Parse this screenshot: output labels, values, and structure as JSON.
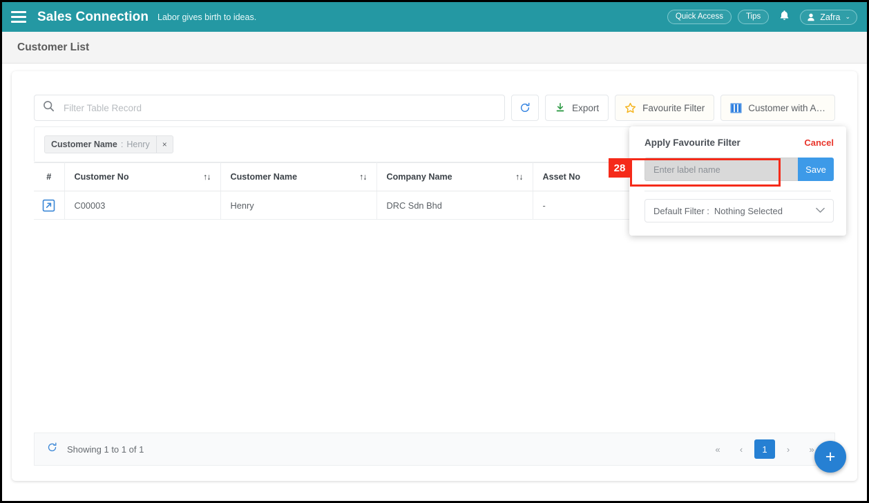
{
  "header": {
    "menu_icon": "hamburger-icon",
    "brand": "Sales Connection",
    "tagline": "Labor gives birth to ideas.",
    "quick_access": "Quick Access",
    "tips": "Tips",
    "bell_icon": "bell-icon",
    "user_name": "Zafra",
    "caret": "⌄",
    "teal": "#2498a3"
  },
  "page": {
    "title": "Customer List"
  },
  "toolbar": {
    "search_placeholder": "Filter Table Record",
    "search_value": "",
    "refresh_label": "",
    "export_label": "Export",
    "favourite_filter_label": "Favourite Filter",
    "column_chooser_label": "Customer with A…"
  },
  "filter_chips": [
    {
      "field": "Customer Name",
      "separator": ":",
      "value": "Henry",
      "remove": "×"
    }
  ],
  "table": {
    "columns": [
      {
        "label": "#",
        "sortable": false
      },
      {
        "label": "Customer No",
        "sortable": true
      },
      {
        "label": "Customer Name",
        "sortable": true
      },
      {
        "label": "Company Name",
        "sortable": true
      },
      {
        "label": "Asset No",
        "sortable": false
      }
    ],
    "sort_glyph": "↑↓",
    "rows": [
      {
        "open_icon": "open-external-icon",
        "customer_no": "C00003",
        "customer_name": "Henry",
        "company_name": "DRC Sdn Bhd",
        "asset_no": "-"
      }
    ]
  },
  "footer": {
    "refresh_icon": "refresh-icon",
    "showing": "Showing 1 to 1 of 1",
    "pager": {
      "first": "«",
      "prev": "‹",
      "pages": [
        "1"
      ],
      "current": "1",
      "next": "›",
      "last": "»"
    }
  },
  "fab": {
    "label": "+",
    "color": "#2680d3"
  },
  "popup": {
    "title": "Apply Favourite Filter",
    "cancel": "Cancel",
    "input_placeholder": "Enter label name",
    "input_value": "",
    "save": "Save",
    "default_filter_label": "Default Filter :",
    "default_filter_value": "Nothing Selected",
    "chevron": "⌄"
  },
  "annotation": {
    "step_number": "28",
    "color": "#f52a19"
  }
}
